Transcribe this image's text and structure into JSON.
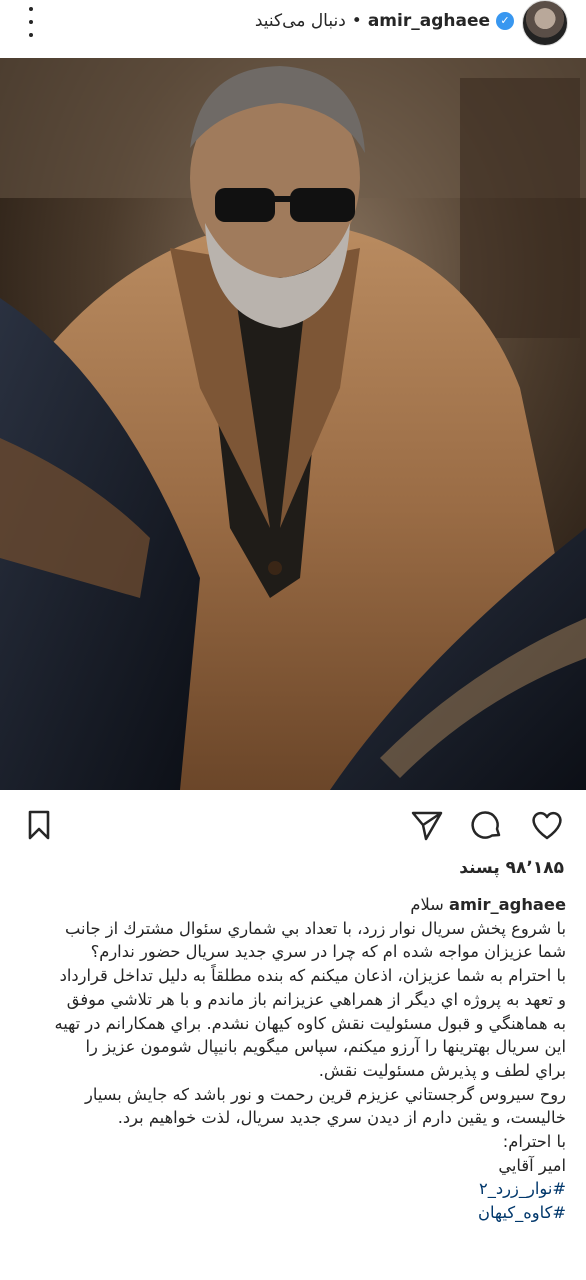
{
  "header": {
    "username": "amir_aghaee",
    "separator": "•",
    "follow_label": "دنبال می‌کنید"
  },
  "icons": {
    "verified": "verified-badge-icon",
    "more": "more-vertical-icon",
    "like": "heart-icon",
    "comment": "comment-bubble-icon",
    "share": "paper-plane-icon",
    "save": "bookmark-icon"
  },
  "post": {
    "likes": "۹۸٬۱۸۵ پسند",
    "caption_user": "amir_aghaee",
    "caption_greeting": "سلام",
    "caption_lines": [
      "با شروع پخش سريال نوار زرد، با تعداد بي شماري سئوال مشترك از جانب",
      "شما عزيزان مواجه شده ام كه چرا در سري جديد سريال حضور ندارم؟",
      "با احترام به شما عزيزان، اذعان ميكنم كه بنده مطلقاً به دليل تداخل قرارداد",
      "و تعهد به پروژه اي ديگر از همراهي عزيزانم باز ماندم و با هر تلاشي موفق",
      "به هماهنگي و قبول مسئوليت نقش كاوه كيهان نشدم. براي همكارانم در تهيه",
      "اين سريال بهترينها را آرزو ميكنم، سپاس ميگويم بانيپال شومون عزيز را",
      "براي لطف و پذيرش مسئوليت نقش.",
      "روح سيروس گرجستاني عزيزم قرين رحمت و نور باشد كه جايش بسيار",
      "خاليست، و يقين دارم از ديدن سري جديد سريال، لذت خواهيم برد.",
      "با احترام:",
      "امير آقايي"
    ],
    "hashtags": [
      "#نوار_زرد_۲",
      "#کاوه_کیهان"
    ]
  }
}
